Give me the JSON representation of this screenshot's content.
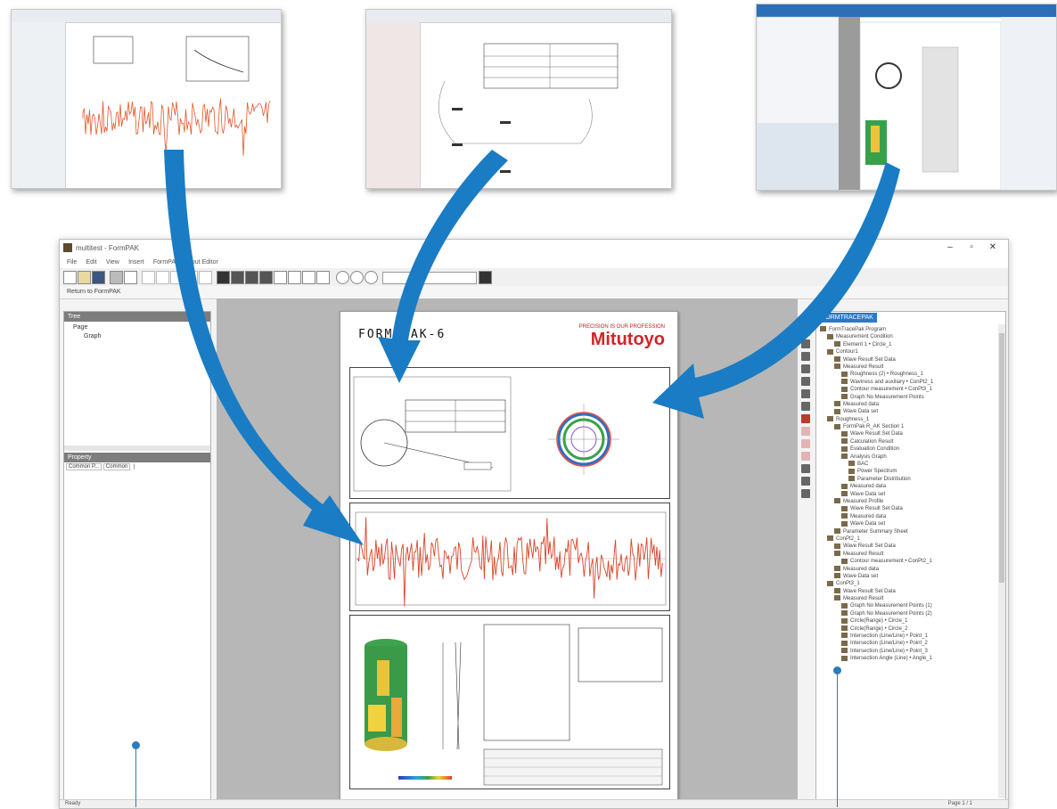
{
  "window": {
    "title": "multitest - FormPAK",
    "menu": [
      "File",
      "Edit",
      "View",
      "Insert",
      "FormPAK Layout Editor"
    ],
    "subtoolbar_label": "Return to FormPAK",
    "controls": {
      "minimize": "–",
      "maximize": "▫",
      "close": "✕"
    }
  },
  "left_pane": {
    "tree_header": "Tree",
    "tree_items": [
      "Page",
      "Graph"
    ],
    "props_header": "Property",
    "props_tabs": [
      "Common P...",
      "Common",
      "|"
    ]
  },
  "document": {
    "title": "FORMTRACEPAK-6",
    "title_visible": "FORM  PAK-6",
    "brand_tagline": "PRECISION IS OUR PROFESSION",
    "brand_name": "Mitutoyo"
  },
  "right_pane": {
    "header": "FORMTRACEPAK",
    "tree": [
      "FormTracePak Program",
      "Measurement Condition",
      "Element 1 • Circle_1",
      "Contour1",
      "Wave Result Set Data",
      "Measured Result",
      "Roughness (2) • Roughness_1",
      "Waviness and auxiliary • ConPt2_1",
      "Contour measurement • ConPt3_1",
      "Graph No Measurement Points",
      "Measured data",
      "Wave Data set",
      "Roughness_1",
      "FormPak R_AK Section 1",
      "Wave Result Set Data",
      "Calculation Result",
      "Evaluation Condition",
      "Analysis Graph",
      "BAC",
      "Power Spectrum",
      "Parameter Distribution",
      "Measured data",
      "Wave Data set",
      "Measured Profile",
      "Wave Result Set Data",
      "Measured data",
      "Wave Data set",
      "Parameter Summary Sheet",
      "ConPt2_1",
      "Wave Result Set Data",
      "Measured Result",
      "Contour measurement • ConPt2_1",
      "Measured data",
      "Wave Data set",
      "ConPt3_1",
      "Wave Result Set Data",
      "Measured Result",
      "Graph No Measurement Points (1)",
      "Graph No Measurement Points (2)",
      "Circle(Range) • Circle_1",
      "Circle(Range) • Circle_2",
      "Intersection (Line/Line) • Point_1",
      "Intersection (Line/Line) • Point_2",
      "Intersection (Line/Line) • Point_3",
      "Intersection Angle (Line) • Angle_1"
    ]
  },
  "status_bar": {
    "left": "Ready",
    "page": "Page 1 / 1"
  }
}
